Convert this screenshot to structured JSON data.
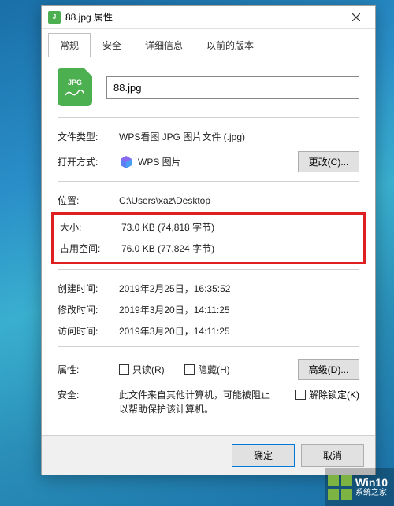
{
  "window": {
    "title": "88.jpg 属性"
  },
  "tabs": {
    "general": "常规",
    "security": "安全",
    "details": "详细信息",
    "previous": "以前的版本"
  },
  "file": {
    "icon_ext": "JPG",
    "name": "88.jpg"
  },
  "rows": {
    "type_label": "文件类型:",
    "type_value": "WPS看图 JPG 图片文件 (.jpg)",
    "open_label": "打开方式:",
    "open_value": "WPS 图片",
    "change_btn": "更改(C)...",
    "location_label": "位置:",
    "location_value": "C:\\Users\\xaz\\Desktop",
    "size_label": "大小:",
    "size_value": "73.0 KB (74,818 字节)",
    "sizeondisk_label": "占用空间:",
    "sizeondisk_value": "76.0 KB (77,824 字节)",
    "created_label": "创建时间:",
    "created_value": "2019年2月25日，16:35:52",
    "modified_label": "修改时间:",
    "modified_value": "2019年3月20日，14:11:25",
    "accessed_label": "访问时间:",
    "accessed_value": "2019年3月20日，14:11:25",
    "attr_label": "属性:",
    "readonly": "只读(R)",
    "hidden": "隐藏(H)",
    "advanced_btn": "高级(D)...",
    "security_label": "安全:",
    "security_text1": "此文件来自其他计算机，可能被阻止",
    "security_text2": "以帮助保护该计算机。",
    "unblock": "解除锁定(K)"
  },
  "buttons": {
    "ok": "确定",
    "cancel": "取消"
  },
  "watermark": {
    "line1": "Win10",
    "line2": "系统之家"
  }
}
